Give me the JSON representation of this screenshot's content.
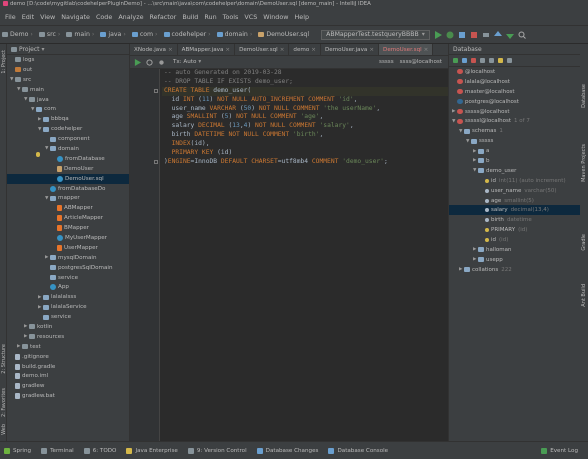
{
  "title_bar": "demo [D:\\code\\mygitlab\\codehelperPluginDemo] - ...\\src\\main\\java\\com\\codehelper\\domain\\DemoUser.sql [demo_main] - IntelliJ IDEA",
  "menu": [
    "File",
    "Edit",
    "View",
    "Navigate",
    "Code",
    "Analyze",
    "Refactor",
    "Build",
    "Run",
    "Tools",
    "VCS",
    "Window",
    "Help"
  ],
  "breadcrumbs": [
    "Demo",
    "src",
    "main",
    "java",
    "com",
    "codehelper",
    "domain",
    "DemoUser.sql"
  ],
  "run_config": "ABMapperTest.testqueryBBBB",
  "project_panel": {
    "title": "Project",
    "tree": [
      {
        "indent": 0,
        "expanded": "none",
        "icon": "folder",
        "label": "logs"
      },
      {
        "indent": 0,
        "expanded": "none",
        "icon": "orange",
        "label": "out"
      },
      {
        "indent": 0,
        "expanded": "open",
        "icon": "folder",
        "label": "src"
      },
      {
        "indent": 1,
        "expanded": "open",
        "icon": "folder",
        "label": "main"
      },
      {
        "indent": 2,
        "expanded": "open",
        "icon": "folder",
        "label": "java"
      },
      {
        "indent": 3,
        "expanded": "open",
        "icon": "pkg",
        "label": "com"
      },
      {
        "indent": 4,
        "expanded": "closed",
        "icon": "pkg",
        "label": "bbbqa"
      },
      {
        "indent": 4,
        "expanded": "open",
        "icon": "pkg",
        "label": "codehelper"
      },
      {
        "indent": 5,
        "expanded": "none",
        "icon": "pkg",
        "label": "component"
      },
      {
        "indent": 5,
        "expanded": "open",
        "icon": "pkg",
        "label": "domain"
      },
      {
        "indent": 6,
        "expanded": "none",
        "icon": "cls",
        "label": "fromDatabase"
      },
      {
        "indent": 6,
        "expanded": "none",
        "icon": "sql",
        "label": "DemoUser"
      },
      {
        "indent": 6,
        "expanded": "none",
        "icon": "cls",
        "label": "DemoUser.sql",
        "selected": true
      },
      {
        "indent": 5,
        "expanded": "none",
        "icon": "cls",
        "label": "fromDatabaseDo"
      },
      {
        "indent": 5,
        "expanded": "open",
        "icon": "pkg",
        "label": "mapper"
      },
      {
        "indent": 6,
        "expanded": "none",
        "icon": "xml",
        "label": "ABMapper"
      },
      {
        "indent": 6,
        "expanded": "none",
        "icon": "xml",
        "label": "ArticleMapper"
      },
      {
        "indent": 6,
        "expanded": "none",
        "icon": "xml",
        "label": "BMapper"
      },
      {
        "indent": 6,
        "expanded": "none",
        "icon": "cls",
        "label": "MyUserMapper"
      },
      {
        "indent": 6,
        "expanded": "none",
        "icon": "xml",
        "label": "UserMapper"
      },
      {
        "indent": 5,
        "expanded": "closed",
        "icon": "pkg",
        "label": "mysqlDomain"
      },
      {
        "indent": 5,
        "expanded": "none",
        "icon": "pkg",
        "label": "postgresSqlDomain"
      },
      {
        "indent": 5,
        "expanded": "none",
        "icon": "pkg",
        "label": "service"
      },
      {
        "indent": 5,
        "expanded": "none",
        "icon": "cls",
        "label": "App"
      },
      {
        "indent": 4,
        "expanded": "closed",
        "icon": "pkg",
        "label": "lalalalsss"
      },
      {
        "indent": 4,
        "expanded": "closed",
        "icon": "pkg",
        "label": "lalalaService"
      },
      {
        "indent": 4,
        "expanded": "none",
        "icon": "pkg",
        "label": "service"
      },
      {
        "indent": 2,
        "expanded": "closed",
        "icon": "folder",
        "label": "kotlin"
      },
      {
        "indent": 2,
        "expanded": "closed",
        "icon": "folder",
        "label": "resources"
      },
      {
        "indent": 1,
        "expanded": "closed",
        "icon": "folder",
        "label": "test"
      },
      {
        "indent": 0,
        "expanded": "none",
        "icon": "file",
        "label": ".gitignore"
      },
      {
        "indent": 0,
        "expanded": "none",
        "icon": "file",
        "label": "build.gradle"
      },
      {
        "indent": 0,
        "expanded": "none",
        "icon": "file",
        "label": "demo.iml"
      },
      {
        "indent": 0,
        "expanded": "none",
        "icon": "file",
        "label": "gradlew"
      },
      {
        "indent": 0,
        "expanded": "none",
        "icon": "file",
        "label": "gradlew.bat"
      }
    ]
  },
  "editor_tabs": [
    {
      "label": "XNode.java",
      "active": false
    },
    {
      "label": "ABMapper.java",
      "active": false
    },
    {
      "label": "DemoUser.sql",
      "active": false
    },
    {
      "label": "demo",
      "active": false
    },
    {
      "label": "DemoUser.java",
      "active": false
    },
    {
      "label": "DemoUser.sql",
      "active": true
    }
  ],
  "editor_toolbar": {
    "tx_mode": "Tx: Auto",
    "schema": "sssss",
    "datasource": "ssss@localhost"
  },
  "code_lines": [
    [
      {
        "c": "cmt",
        "t": "-- auto Generated on 2019-03-28"
      }
    ],
    [
      {
        "c": "cmt",
        "t": "-- DROP TABLE IF EXISTS demo_user;"
      }
    ],
    [
      {
        "c": "kw",
        "t": "CREATE TABLE "
      },
      {
        "c": "id",
        "t": "demo_user("
      }
    ],
    [
      {
        "c": "id",
        "t": "  id "
      },
      {
        "c": "kw",
        "t": "INT "
      },
      {
        "c": "id",
        "t": "("
      },
      {
        "c": "num",
        "t": "11"
      },
      {
        "c": "id",
        "t": ") "
      },
      {
        "c": "kw",
        "t": "NOT NULL AUTO_INCREMENT COMMENT "
      },
      {
        "c": "str",
        "t": "'id'"
      },
      {
        "c": "id",
        "t": ","
      }
    ],
    [
      {
        "c": "id",
        "t": "  user_name "
      },
      {
        "c": "kw",
        "t": "VARCHAR "
      },
      {
        "c": "id",
        "t": "("
      },
      {
        "c": "num",
        "t": "50"
      },
      {
        "c": "id",
        "t": ") "
      },
      {
        "c": "kw",
        "t": "NOT NULL COMMENT "
      },
      {
        "c": "str",
        "t": "'the userName'"
      },
      {
        "c": "id",
        "t": ","
      }
    ],
    [
      {
        "c": "id",
        "t": "  age "
      },
      {
        "c": "kw",
        "t": "SMALLINT "
      },
      {
        "c": "id",
        "t": "("
      },
      {
        "c": "num",
        "t": "5"
      },
      {
        "c": "id",
        "t": ") "
      },
      {
        "c": "kw",
        "t": "NOT NULL COMMENT "
      },
      {
        "c": "str",
        "t": "'age'"
      },
      {
        "c": "id",
        "t": ","
      }
    ],
    [
      {
        "c": "id",
        "t": "  salary "
      },
      {
        "c": "kw",
        "t": "DECIMAL "
      },
      {
        "c": "id",
        "t": "("
      },
      {
        "c": "num",
        "t": "13"
      },
      {
        "c": "id",
        "t": ","
      },
      {
        "c": "num",
        "t": "4"
      },
      {
        "c": "id",
        "t": ") "
      },
      {
        "c": "kw",
        "t": "NOT NULL COMMENT "
      },
      {
        "c": "str",
        "t": "'salary'"
      },
      {
        "c": "id",
        "t": ","
      }
    ],
    [
      {
        "c": "id",
        "t": "  birth "
      },
      {
        "c": "kw",
        "t": "DATETIME NOT NULL COMMENT "
      },
      {
        "c": "str",
        "t": "'birth'"
      },
      {
        "c": "id",
        "t": ","
      }
    ],
    [
      {
        "c": "kw",
        "t": "  INDEX"
      },
      {
        "c": "id",
        "t": "(id),"
      }
    ],
    [
      {
        "c": "kw",
        "t": "  PRIMARY KEY "
      },
      {
        "c": "id",
        "t": "(id)"
      }
    ],
    [
      {
        "c": "id",
        "t": ")"
      },
      {
        "c": "kw",
        "t": "ENGINE"
      },
      {
        "c": "id",
        "t": "=InnoDB "
      },
      {
        "c": "kw",
        "t": "DEFAULT CHARSET"
      },
      {
        "c": "id",
        "t": "=utf8mb4 "
      },
      {
        "c": "kw",
        "t": "COMMENT "
      },
      {
        "c": "str",
        "t": "'demo_user'"
      },
      {
        "c": "id",
        "t": ";"
      }
    ]
  ],
  "db_panel": {
    "title": "Database",
    "tree": [
      {
        "indent": 0,
        "expanded": "none",
        "icon": "db",
        "label": "@localhost",
        "dim": ""
      },
      {
        "indent": 0,
        "expanded": "none",
        "icon": "db",
        "label": "lalala@localhost",
        "dim": ""
      },
      {
        "indent": 0,
        "expanded": "none",
        "icon": "db",
        "label": "master@localhost",
        "dim": ""
      },
      {
        "indent": 0,
        "expanded": "none",
        "icon": "pg",
        "label": "postgres@localhost",
        "dim": ""
      },
      {
        "indent": 0,
        "expanded": "closed",
        "icon": "db",
        "label": "sssss@localhost",
        "dim": ""
      },
      {
        "indent": 0,
        "expanded": "open",
        "icon": "db",
        "label": "sssssl@localhost",
        "dim": "1 of 7"
      },
      {
        "indent": 1,
        "expanded": "open",
        "icon": "tbl",
        "label": "schemas",
        "dim": "1"
      },
      {
        "indent": 2,
        "expanded": "open",
        "icon": "tbl",
        "label": "sssss",
        "dim": ""
      },
      {
        "indent": 3,
        "expanded": "closed",
        "icon": "tbl",
        "label": "a",
        "dim": ""
      },
      {
        "indent": 3,
        "expanded": "closed",
        "icon": "tbl",
        "label": "b",
        "dim": ""
      },
      {
        "indent": 3,
        "expanded": "open",
        "icon": "tbl",
        "label": "demo_user",
        "dim": ""
      },
      {
        "indent": 4,
        "expanded": "none",
        "icon": "key",
        "label": "id",
        "dim": "int(11) (auto increment)"
      },
      {
        "indent": 4,
        "expanded": "none",
        "icon": "col",
        "label": "user_name",
        "dim": "varchar(50)"
      },
      {
        "indent": 4,
        "expanded": "none",
        "icon": "col",
        "label": "age",
        "dim": "smallint(5)"
      },
      {
        "indent": 4,
        "expanded": "none",
        "icon": "col",
        "label": "salary",
        "dim": "decimal(13,4)",
        "selected": true
      },
      {
        "indent": 4,
        "expanded": "none",
        "icon": "col",
        "label": "birth",
        "dim": "datetime"
      },
      {
        "indent": 4,
        "expanded": "none",
        "icon": "key",
        "label": "PRIMARY",
        "dim": "(id)"
      },
      {
        "indent": 4,
        "expanded": "none",
        "icon": "key",
        "label": "id",
        "dim": "(id)"
      },
      {
        "indent": 3,
        "expanded": "closed",
        "icon": "tbl",
        "label": "halloman",
        "dim": ""
      },
      {
        "indent": 3,
        "expanded": "closed",
        "icon": "tbl",
        "label": "usepp",
        "dim": ""
      },
      {
        "indent": 1,
        "expanded": "closed",
        "icon": "tbl",
        "label": "collations",
        "dim": "222"
      }
    ]
  },
  "left_strip_labels": [
    "1: Project",
    "2: Structure",
    "2: Favorites",
    "Web",
    "Database"
  ],
  "right_strip_labels": [
    "Database",
    "Maven Projects",
    "Gradle",
    "Ant Build"
  ],
  "bottom_tools": [
    {
      "label": "Spring",
      "color": "#6db33f"
    },
    {
      "label": "Terminal",
      "color": "#87939a"
    },
    {
      "label": "6: TODO",
      "color": "#87939a"
    },
    {
      "label": "Java Enterprise",
      "color": "#d4b84a"
    },
    {
      "label": "9: Version Control",
      "color": "#87939a"
    },
    {
      "label": "Database Changes",
      "color": "#6a9fcf"
    },
    {
      "label": "Database Console",
      "color": "#6a9fcf"
    }
  ],
  "event_log": "Event Log",
  "colors": {
    "editor_bg": "#2b2b2b",
    "panel_bg": "#3c3f41",
    "keyword": "#cc7832",
    "string": "#6a8759",
    "number": "#6897bb",
    "comment": "#808080"
  }
}
